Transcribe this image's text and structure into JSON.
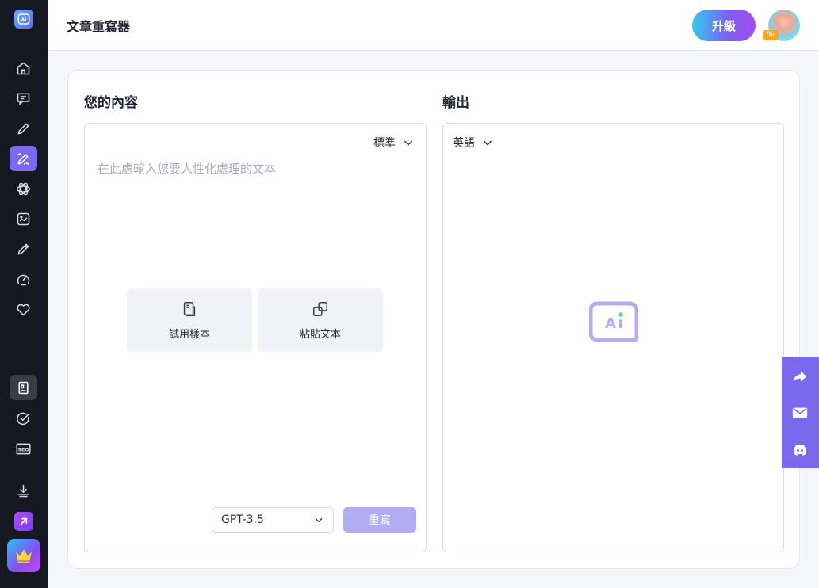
{
  "header": {
    "title": "文章重寫器",
    "upgrade_label": "升級",
    "avatar_badge": "%"
  },
  "sidebar": {
    "items": [
      {
        "icon": "home-icon"
      },
      {
        "icon": "chat-icon"
      },
      {
        "icon": "pencil-icon"
      },
      {
        "icon": "rewrite-icon",
        "active": true
      },
      {
        "icon": "atom-icon"
      },
      {
        "icon": "image-icon"
      },
      {
        "icon": "edit-icon"
      },
      {
        "icon": "speed-icon"
      },
      {
        "icon": "heart-icon"
      },
      {
        "icon": "document-icon"
      },
      {
        "icon": "check-icon"
      },
      {
        "icon": "seo-icon",
        "label": "SEO"
      },
      {
        "icon": "download-icon"
      },
      {
        "icon": "arrow-up-right-icon"
      },
      {
        "icon": "crown-icon"
      }
    ]
  },
  "input_panel": {
    "title": "您的內容",
    "mode_label": "標準",
    "placeholder": "在此處輸入您要人性化處理的文本",
    "sample_label": "試用樣本",
    "paste_label": "粘貼文本",
    "model_label": "GPT-3.5",
    "rewrite_label": "重寫"
  },
  "output_panel": {
    "title": "輸出",
    "language_label": "英語"
  },
  "colors": {
    "accent": "#7b68ee",
    "sidebar_bg": "#151821",
    "rewrite_disabled": "#b2acf2"
  },
  "float_bar": {
    "items": [
      "share-icon",
      "mail-icon",
      "discord-icon"
    ]
  }
}
